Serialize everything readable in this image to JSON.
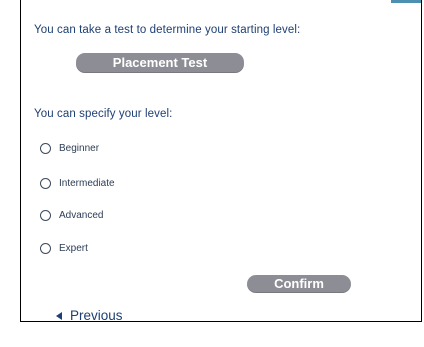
{
  "placement": {
    "prompt": "You can take a test to determine your starting level:",
    "button_label": "Placement Test"
  },
  "level": {
    "prompt": "You can specify your level:",
    "options": [
      {
        "label": "Beginner"
      },
      {
        "label": "Intermediate"
      },
      {
        "label": "Advanced"
      },
      {
        "label": "Expert"
      }
    ]
  },
  "actions": {
    "confirm_label": "Confirm",
    "previous_label": "Previous"
  },
  "colors": {
    "heading_text": "#1e3f73",
    "button_bg": "#8d8d95",
    "accent": "#4d8fb0"
  }
}
